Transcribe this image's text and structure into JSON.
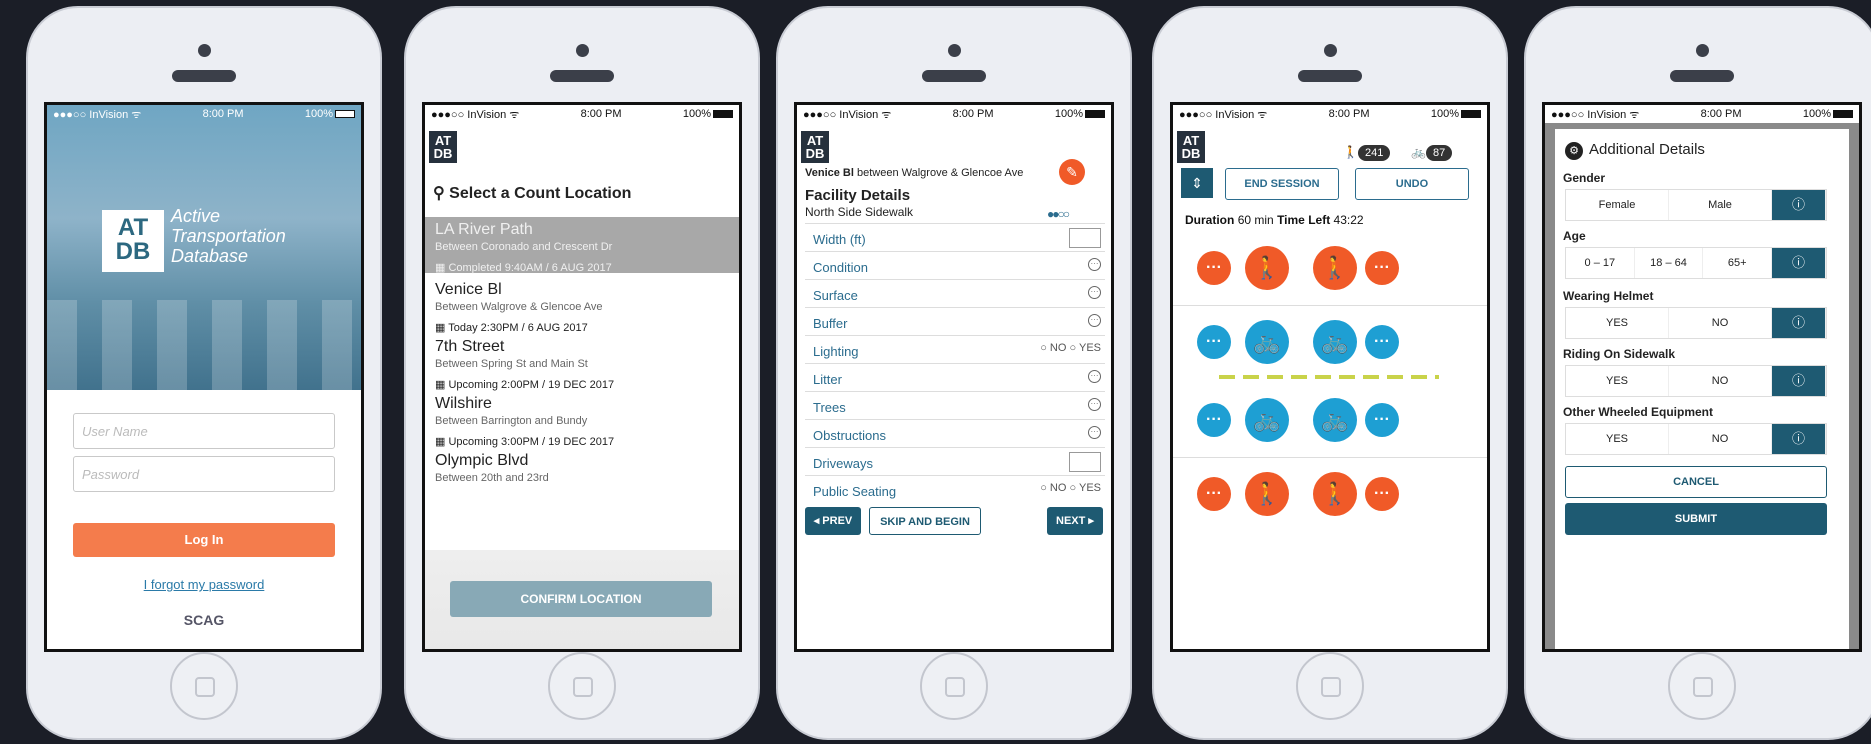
{
  "status": {
    "carrier": "●●●○○ InVision ᯤ",
    "time": "8:00 PM",
    "battery": "100%"
  },
  "logo_small": "AT\nDB",
  "p1": {
    "logo": "AT\nDB",
    "title": "Active\nTransportation\nDatabase",
    "username": "User Name",
    "password": "Password",
    "login": "Log In",
    "forgot": "I forgot my password",
    "brand": "SCAG"
  },
  "p2": {
    "heading": "Select a Count Location",
    "confirm": "CONFIRM LOCATION",
    "locations": [
      {
        "name": "LA River Path",
        "sub": "Between Coronado and Crescent Dr",
        "date": "Completed 9:40AM / 6 AUG 2017"
      },
      {
        "name": "Venice Bl",
        "sub": "Between Walgrove & Glencoe Ave",
        "date": "Today 2:30PM / 6 AUG 2017"
      },
      {
        "name": "7th Street",
        "sub": "Between Spring St and Main St",
        "date": "Upcoming 2:00PM / 19 DEC 2017"
      },
      {
        "name": "Wilshire",
        "sub": "Between Barrington and Bundy",
        "date": "Upcoming 3:00PM / 19 DEC 2017"
      },
      {
        "name": "Olympic Blvd",
        "sub": "Between 20th and 23rd",
        "date": ""
      }
    ]
  },
  "p3": {
    "street": "Venice Bl",
    "between": "between Walgrove & Glencoe Ave",
    "title": "Facility Details",
    "sub": "North Side Sidewalk",
    "rows": [
      "Width (ft)",
      "Condition",
      "Surface",
      "Buffer",
      "Lighting",
      "Litter",
      "Trees",
      "Obstructions",
      "Driveways",
      "Public Seating"
    ],
    "no": "○ NO",
    "yes": "○ YES",
    "prev": "◂ PREV",
    "skip": "SKIP AND BEGIN",
    "next": "NEXT ▸"
  },
  "p4": {
    "ped": "241",
    "bike": "87",
    "end": "END SESSION",
    "undo": "UNDO",
    "dur_label": "Duration",
    "dur": "60 min",
    "left_label": "Time Left",
    "left": "43:22"
  },
  "p5": {
    "title": "Additional Details",
    "gender": "Gender",
    "female": "Female",
    "male": "Male",
    "age": "Age",
    "a1": "0 – 17",
    "a2": "18 – 64",
    "a3": "65+",
    "helmet": "Wearing Helmet",
    "sidewalk": "Riding On Sidewalk",
    "other": "Other Wheeled Equipment",
    "yes": "YES",
    "no": "NO",
    "q": "?",
    "cancel": "CANCEL",
    "submit": "SUBMIT"
  },
  "colors": {
    "orange": "#f05a28",
    "blue": "#1e9fd3",
    "navy": "#1e5a72"
  }
}
